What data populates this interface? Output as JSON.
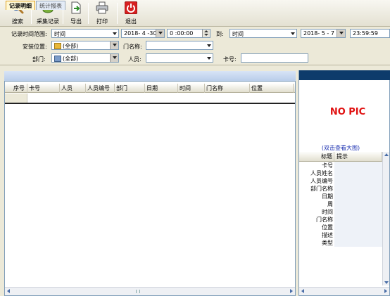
{
  "toolbar": {
    "search_label": "搜索",
    "collect_label": "采集记录",
    "export_label": "导出",
    "print_label": "打印",
    "exit_label": "退出"
  },
  "filters": {
    "record_time_label": "记录时间范围:",
    "time_type_value": "时间",
    "start_date": "2018- 4 -30",
    "start_time": "0 :00:00",
    "to_label": "到:",
    "end_time_type_value": "时间",
    "end_date": "2018- 5 - 7",
    "end_time": "23:59:59",
    "install_location_label": "安装位置:",
    "install_location_value": "(全部)",
    "door_name_label": "门名称:",
    "door_name_value": "",
    "department_label": "部门:",
    "department_value": "(全部)",
    "person_label": "人员:",
    "person_value": "",
    "card_label": "卡号:",
    "card_value": ""
  },
  "tabs": [
    "记录明细",
    "统计报表"
  ],
  "grid": {
    "columns": [
      "序号",
      "卡号",
      "人员",
      "人员编号",
      "部门",
      "日期",
      "时间",
      "门名称",
      "位置"
    ]
  },
  "photo": {
    "no_pic_text": "NO PIC",
    "double_click_hint": "(双击查看大图)"
  },
  "properties": {
    "header_title": "标题",
    "header_hint": "提示",
    "rows": [
      "卡号",
      "人员姓名",
      "人员编号",
      "部门名称",
      "日期",
      "周",
      "时间",
      "门名称",
      "位置",
      "描述",
      "类型"
    ]
  },
  "colors": {
    "accent_navy": "#0d3b6b",
    "no_pic_red": "#e01010",
    "link_blue": "#1a2fb0"
  }
}
